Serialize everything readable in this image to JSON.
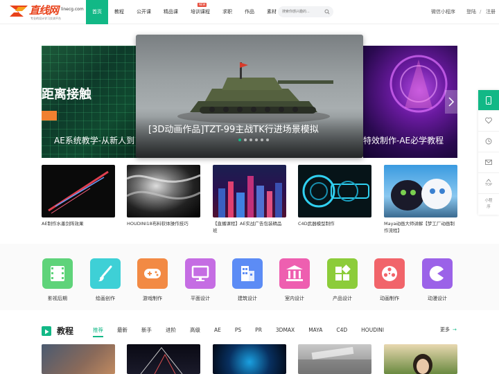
{
  "header": {
    "logo_text": "直线网",
    "logo_domain": "linecg.com",
    "logo_slogan": "专业的设计学习交流平台",
    "nav": [
      "首页",
      "教程",
      "公开课",
      "精品课",
      "培训课程",
      "求职",
      "作品",
      "素材"
    ],
    "new_badge": "NEW",
    "search_placeholder": "搜索你感兴趣的...",
    "mini_program": "微信小程序",
    "login": "登陆",
    "separator": "/",
    "register": "注册"
  },
  "banner": {
    "left_big_text": "距离接触",
    "left_caption": "AE系统教学-从新人到",
    "main_caption": "[3D动画作品]TZT-99主战TK行进场景模拟",
    "right_caption": "特效制作-AE必学教程",
    "dots": 6,
    "active_dot": 0
  },
  "thumbnails": [
    {
      "title": "AE制作水墨剑阵效果"
    },
    {
      "title": "HOUDINI18布料软体操作技巧"
    },
    {
      "title": "【直播课程】AE实战广告包装精品班"
    },
    {
      "title": "C4D武器模型制作"
    },
    {
      "title": "Maya动画大师讲解【梦工厂动画制作流程】"
    }
  ],
  "categories": [
    {
      "label": "影视后期",
      "color": "#5fd37a",
      "icon": "film-icon"
    },
    {
      "label": "绘画创作",
      "color": "#3ed0d6",
      "icon": "brush-icon"
    },
    {
      "label": "游戏制作",
      "color": "#f28a44",
      "icon": "gamepad-icon"
    },
    {
      "label": "平面设计",
      "color": "#c56de3",
      "icon": "monitor-icon"
    },
    {
      "label": "建筑设计",
      "color": "#5c8cf5",
      "icon": "building-icon"
    },
    {
      "label": "室内设计",
      "color": "#ee5fb0",
      "icon": "columns-icon"
    },
    {
      "label": "产品设计",
      "color": "#8ccc3a",
      "icon": "blocks-icon"
    },
    {
      "label": "动画制作",
      "color": "#f1646a",
      "icon": "reel-icon"
    },
    {
      "label": "动漫设计",
      "color": "#9b62e8",
      "icon": "pacman-icon"
    }
  ],
  "courses": {
    "title": "教程",
    "tabs": [
      "推荐",
      "最新",
      "新手",
      "进阶",
      "高级",
      "AE",
      "PS",
      "PR",
      "3DMAX",
      "MAYA",
      "C4D",
      "HOUDINI"
    ],
    "active_tab": 0,
    "more": "更多"
  },
  "side_toolbar": {
    "top": "TOP",
    "mini": "小程序"
  },
  "colors": {
    "brand": "#12b886",
    "logo": "#e8421a"
  }
}
